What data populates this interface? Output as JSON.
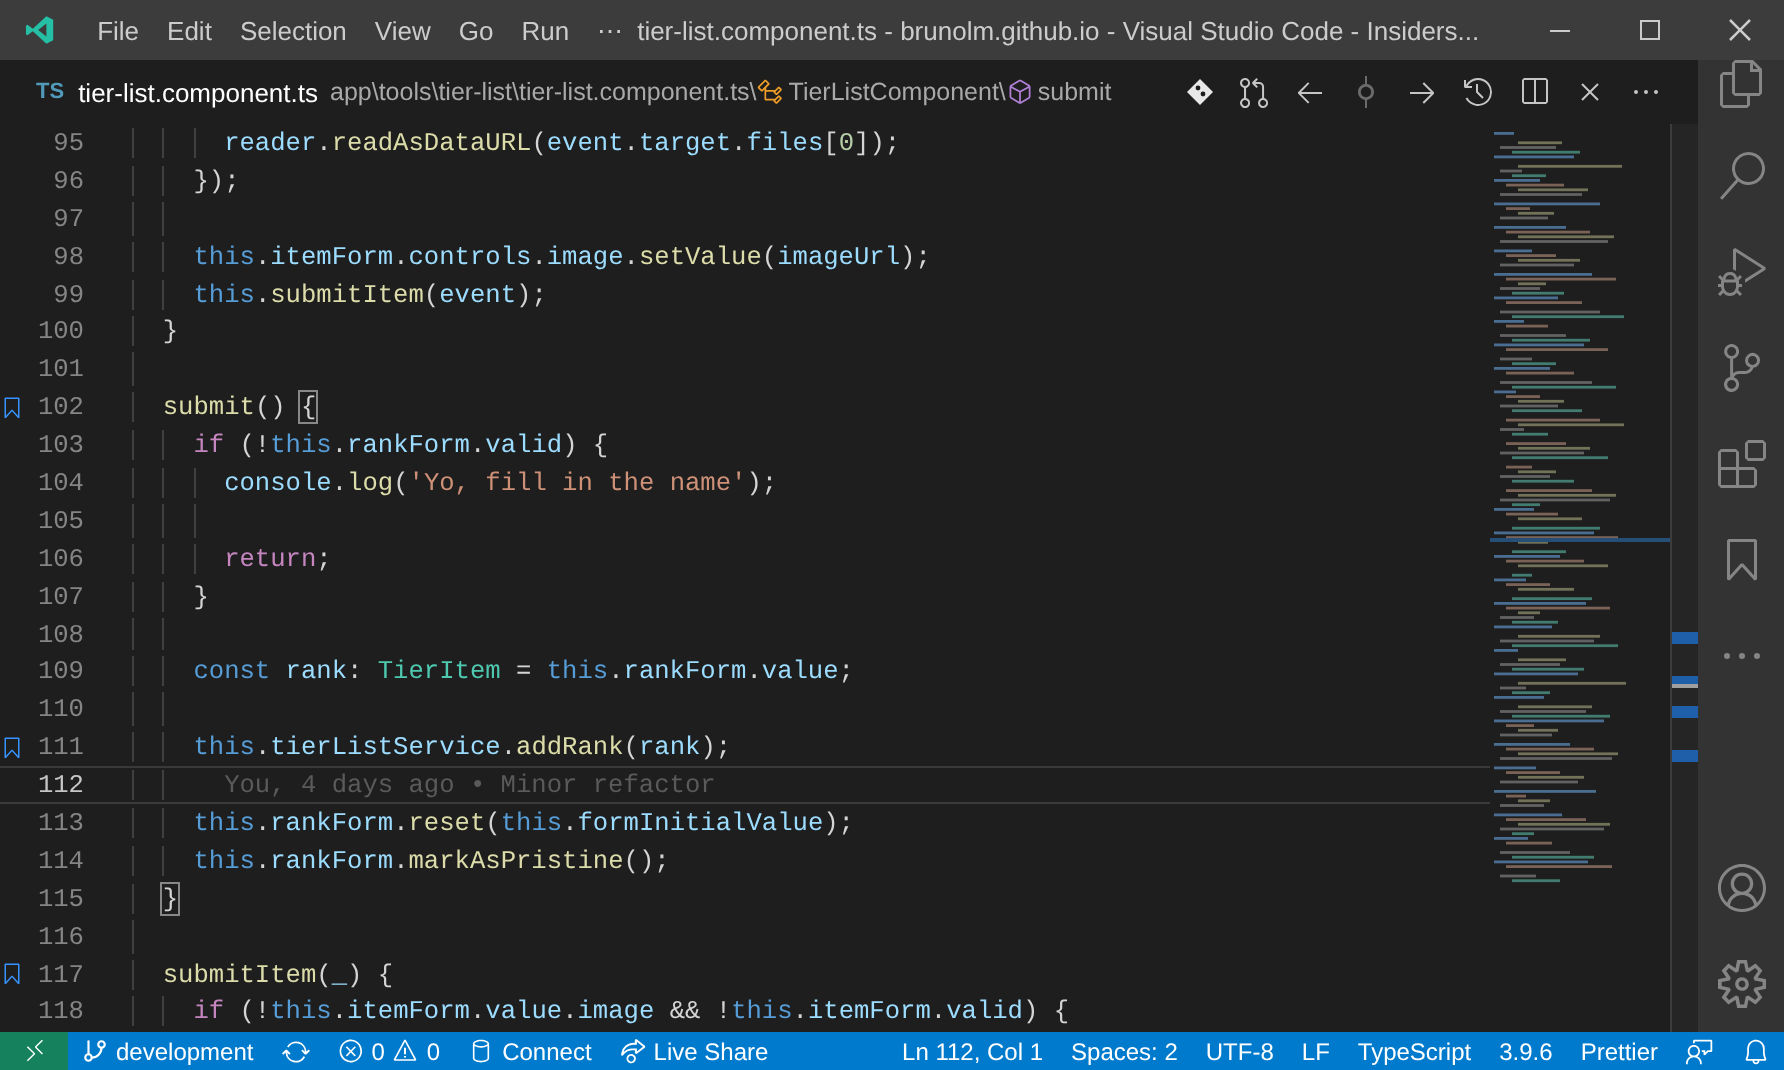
{
  "window": {
    "title": "tier-list.component.ts - brunolm.github.io - Visual Studio Code - Insiders...",
    "menu": [
      "File",
      "Edit",
      "Selection",
      "View",
      "Go",
      "Run"
    ],
    "menu_more": "⋯"
  },
  "editor": {
    "language_badge": "TS",
    "file_name": "tier-list.component.ts",
    "breadcrumbs": [
      {
        "kind": "path",
        "text": "app\\tools\\tier-list\\tier-list.component.ts\\"
      },
      {
        "kind": "class",
        "text": "TierListComponent\\"
      },
      {
        "kind": "method",
        "text": "submit"
      }
    ],
    "lines": [
      {
        "number": "95",
        "bookmark": false,
        "current": false,
        "tokens": [
          {
            "text": "      reader",
            "kind": "variable"
          },
          {
            "text": ".",
            "kind": "plain"
          },
          {
            "text": "readAsDataURL",
            "kind": "function"
          },
          {
            "text": "(",
            "kind": "plain"
          },
          {
            "text": "event",
            "kind": "variable"
          },
          {
            "text": ".",
            "kind": "plain"
          },
          {
            "text": "target",
            "kind": "variable"
          },
          {
            "text": ".",
            "kind": "plain"
          },
          {
            "text": "files",
            "kind": "variable"
          },
          {
            "text": "[",
            "kind": "plain"
          },
          {
            "text": "0",
            "kind": "number"
          },
          {
            "text": "]);",
            "kind": "plain"
          }
        ]
      },
      {
        "number": "96",
        "bookmark": false,
        "current": false,
        "tokens": [
          {
            "text": "    });",
            "kind": "plain"
          }
        ]
      },
      {
        "number": "97",
        "bookmark": false,
        "current": false
      },
      {
        "number": "98",
        "bookmark": false,
        "current": false,
        "tokens": [
          {
            "text": "    this",
            "kind": "keyword"
          },
          {
            "text": ".",
            "kind": "plain"
          },
          {
            "text": "itemForm",
            "kind": "variable"
          },
          {
            "text": ".",
            "kind": "plain"
          },
          {
            "text": "controls",
            "kind": "variable"
          },
          {
            "text": ".",
            "kind": "plain"
          },
          {
            "text": "image",
            "kind": "variable"
          },
          {
            "text": ".",
            "kind": "plain"
          },
          {
            "text": "setValue",
            "kind": "function"
          },
          {
            "text": "(",
            "kind": "plain"
          },
          {
            "text": "imageUrl",
            "kind": "variable"
          },
          {
            "text": ");",
            "kind": "plain"
          }
        ]
      },
      {
        "number": "99",
        "bookmark": false,
        "current": false,
        "tokens": [
          {
            "text": "    this",
            "kind": "keyword"
          },
          {
            "text": ".",
            "kind": "plain"
          },
          {
            "text": "submitItem",
            "kind": "function"
          },
          {
            "text": "(",
            "kind": "plain"
          },
          {
            "text": "event",
            "kind": "variable"
          },
          {
            "text": ");",
            "kind": "plain"
          }
        ]
      },
      {
        "number": "100",
        "bookmark": false,
        "current": false,
        "tokens": [
          {
            "text": "  }",
            "kind": "plain"
          }
        ]
      },
      {
        "number": "101",
        "bookmark": false,
        "current": false
      },
      {
        "number": "102",
        "bookmark": true,
        "current": false,
        "tokens": [
          {
            "text": "  submit",
            "kind": "function"
          },
          {
            "text": "() ",
            "kind": "plain"
          },
          {
            "text": "{",
            "kind": "bracket"
          }
        ]
      },
      {
        "number": "103",
        "bookmark": false,
        "current": false,
        "tokens": [
          {
            "text": "    if",
            "kind": "control"
          },
          {
            "text": " (!",
            "kind": "plain"
          },
          {
            "text": "this",
            "kind": "keyword"
          },
          {
            "text": ".",
            "kind": "plain"
          },
          {
            "text": "rankForm",
            "kind": "variable"
          },
          {
            "text": ".",
            "kind": "plain"
          },
          {
            "text": "valid",
            "kind": "variable"
          },
          {
            "text": ") {",
            "kind": "plain"
          }
        ]
      },
      {
        "number": "104",
        "bookmark": false,
        "current": false,
        "tokens": [
          {
            "text": "      console",
            "kind": "variable"
          },
          {
            "text": ".",
            "kind": "plain"
          },
          {
            "text": "log",
            "kind": "function"
          },
          {
            "text": "(",
            "kind": "plain"
          },
          {
            "text": "'Yo, fill in the name'",
            "kind": "string"
          },
          {
            "text": ");",
            "kind": "plain"
          }
        ]
      },
      {
        "number": "105",
        "bookmark": false,
        "current": false
      },
      {
        "number": "106",
        "bookmark": false,
        "current": false,
        "tokens": [
          {
            "text": "      return",
            "kind": "control"
          },
          {
            "text": ";",
            "kind": "plain"
          }
        ]
      },
      {
        "number": "107",
        "bookmark": false,
        "current": false,
        "tokens": [
          {
            "text": "    }",
            "kind": "plain"
          }
        ]
      },
      {
        "number": "108",
        "bookmark": false,
        "current": false
      },
      {
        "number": "109",
        "bookmark": false,
        "current": false,
        "tokens": [
          {
            "text": "    const ",
            "kind": "keyword"
          },
          {
            "text": "rank",
            "kind": "variable"
          },
          {
            "text": ": ",
            "kind": "plain"
          },
          {
            "text": "TierItem",
            "kind": "type"
          },
          {
            "text": " = ",
            "kind": "plain"
          },
          {
            "text": "this",
            "kind": "keyword"
          },
          {
            "text": ".",
            "kind": "plain"
          },
          {
            "text": "rankForm",
            "kind": "variable"
          },
          {
            "text": ".",
            "kind": "plain"
          },
          {
            "text": "value",
            "kind": "variable"
          },
          {
            "text": ";",
            "kind": "plain"
          }
        ]
      },
      {
        "number": "110",
        "bookmark": false,
        "current": false
      },
      {
        "number": "111",
        "bookmark": true,
        "current": false,
        "tokens": [
          {
            "text": "    this",
            "kind": "keyword"
          },
          {
            "text": ".",
            "kind": "plain"
          },
          {
            "text": "tierListService",
            "kind": "variable"
          },
          {
            "text": ".",
            "kind": "plain"
          },
          {
            "text": "addRank",
            "kind": "function"
          },
          {
            "text": "(",
            "kind": "plain"
          },
          {
            "text": "rank",
            "kind": "variable"
          },
          {
            "text": ");",
            "kind": "plain"
          }
        ]
      },
      {
        "number": "112",
        "bookmark": false,
        "current": true,
        "blame": "You, 4 days ago • Minor refactor"
      },
      {
        "number": "113",
        "bookmark": false,
        "current": false,
        "tokens": [
          {
            "text": "    this",
            "kind": "keyword"
          },
          {
            "text": ".",
            "kind": "plain"
          },
          {
            "text": "rankForm",
            "kind": "variable"
          },
          {
            "text": ".",
            "kind": "plain"
          },
          {
            "text": "reset",
            "kind": "function"
          },
          {
            "text": "(",
            "kind": "plain"
          },
          {
            "text": "this",
            "kind": "keyword"
          },
          {
            "text": ".",
            "kind": "plain"
          },
          {
            "text": "formInitialValue",
            "kind": "variable"
          },
          {
            "text": ");",
            "kind": "plain"
          }
        ]
      },
      {
        "number": "114",
        "bookmark": false,
        "current": false,
        "tokens": [
          {
            "text": "    this",
            "kind": "keyword"
          },
          {
            "text": ".",
            "kind": "plain"
          },
          {
            "text": "rankForm",
            "kind": "variable"
          },
          {
            "text": ".",
            "kind": "plain"
          },
          {
            "text": "markAsPristine",
            "kind": "function"
          },
          {
            "text": "();",
            "kind": "plain"
          }
        ]
      },
      {
        "number": "115",
        "bookmark": false,
        "current": false,
        "tokens": [
          {
            "text": "  }",
            "kind": "bracket"
          }
        ]
      },
      {
        "number": "116",
        "bookmark": false,
        "current": false
      },
      {
        "number": "117",
        "bookmark": true,
        "current": false,
        "tokens": [
          {
            "text": "  submitItem",
            "kind": "function"
          },
          {
            "text": "(",
            "kind": "plain"
          },
          {
            "text": "_",
            "kind": "variable"
          },
          {
            "text": ") {",
            "kind": "plain"
          }
        ]
      },
      {
        "number": "118",
        "bookmark": false,
        "current": false,
        "tokens": [
          {
            "text": "    if",
            "kind": "control"
          },
          {
            "text": " (!",
            "kind": "plain"
          },
          {
            "text": "this",
            "kind": "keyword"
          },
          {
            "text": ".",
            "kind": "plain"
          },
          {
            "text": "itemForm",
            "kind": "variable"
          },
          {
            "text": ".",
            "kind": "plain"
          },
          {
            "text": "value",
            "kind": "variable"
          },
          {
            "text": ".",
            "kind": "plain"
          },
          {
            "text": "image",
            "kind": "variable"
          },
          {
            "text": " && !",
            "kind": "plain"
          },
          {
            "text": "this",
            "kind": "keyword"
          },
          {
            "text": ".",
            "kind": "plain"
          },
          {
            "text": "itemForm",
            "kind": "variable"
          },
          {
            "text": ".",
            "kind": "plain"
          },
          {
            "text": "valid",
            "kind": "variable"
          },
          {
            "text": ") {",
            "kind": "plain"
          }
        ]
      }
    ]
  },
  "status_bar": {
    "left": [
      {
        "kind": "remote"
      },
      {
        "kind": "branch",
        "text": "development"
      },
      {
        "kind": "sync"
      },
      {
        "kind": "errors",
        "text": "0"
      },
      {
        "kind": "warnings",
        "text": "0"
      },
      {
        "kind": "database",
        "text": "Connect"
      },
      {
        "kind": "liveshare",
        "text": "Live Share"
      }
    ],
    "right": [
      {
        "kind": "text",
        "text": "Ln 112, Col 1"
      },
      {
        "kind": "text",
        "text": "Spaces: 2"
      },
      {
        "kind": "text",
        "text": "UTF-8"
      },
      {
        "kind": "text",
        "text": "LF"
      },
      {
        "kind": "text",
        "text": "TypeScript"
      },
      {
        "kind": "text",
        "text": "3.9.6"
      },
      {
        "kind": "text",
        "text": "Prettier"
      },
      {
        "kind": "feedback"
      },
      {
        "kind": "bell"
      }
    ]
  }
}
